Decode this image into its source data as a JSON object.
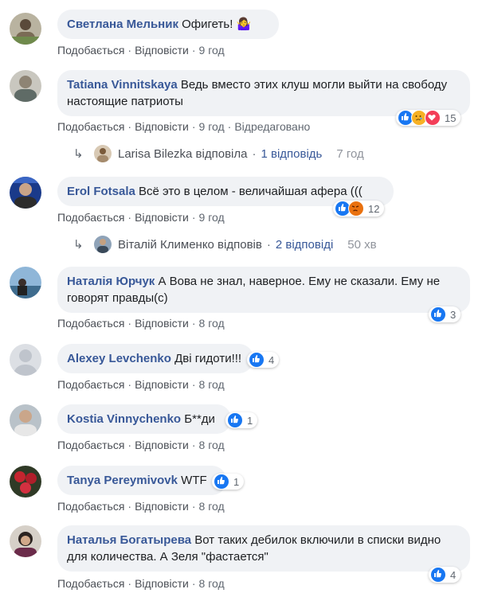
{
  "comments": [
    {
      "author": "Светлана Мельник",
      "text": "Офигеть! 🤷‍♀️",
      "like": "Подобається",
      "reply": "Відповісти",
      "time": "9 год",
      "edited": ""
    },
    {
      "author": "Tatiana Vinnitskaya",
      "text": "Ведь вместо этих клуш могли выйти на свободу настоящие патриоты",
      "like": "Подобається",
      "reply": "Відповісти",
      "time": "9 год",
      "edited": "Відредаговано",
      "reactions_count": "15"
    },
    {
      "author": "Erol Fotsala",
      "text": "Всё это в целом - величайшая афера (((",
      "like": "Подобається",
      "reply": "Відповісти",
      "time": "9 год",
      "reactions_count": "12"
    },
    {
      "author": "Наталія Юрчук",
      "text": "А Вова не знал, наверное. Ему не сказали. Ему не говорят правды(с)",
      "like": "Подобається",
      "reply": "Відповісти",
      "time": "8 год",
      "reactions_count": "3"
    },
    {
      "author": "Alexey Levchenko",
      "text": "Дві гидоти!!!",
      "like": "Подобається",
      "reply": "Відповісти",
      "time": "8 год",
      "reactions_count": "4"
    },
    {
      "author": "Kostia Vinnychenko",
      "text": "Б**ди",
      "like": "Подобається",
      "reply": "Відповісти",
      "time": "8 год",
      "reactions_count": "1"
    },
    {
      "author": "Tanya Pereymivovk",
      "text": "WTF",
      "like": "Подобається",
      "reply": "Відповісти",
      "time": "8 год",
      "reactions_count": "1"
    },
    {
      "author": "Наталья Богатырева",
      "text": "Вот таких дебилок включили в списки видно для количества. А Зеля \"фастается\"",
      "like": "Подобається",
      "reply": "Відповісти",
      "time": "8 год",
      "reactions_count": "4"
    }
  ],
  "replies": [
    {
      "who": "Larisa Bilezka відповіла",
      "sep": "·",
      "count": "1 відповідь",
      "time": "7 год"
    },
    {
      "who": "Віталій Клименко відповів",
      "sep": "·",
      "count": "2 відповіді",
      "time": "50 хв"
    }
  ],
  "colors": {
    "author": "#385898",
    "bubble": "#f0f2f5",
    "like_blue": "#1877f2",
    "love_red": "#f33e58",
    "sad_yellow": "#f7b125",
    "angry_orange": "#e9710f"
  }
}
